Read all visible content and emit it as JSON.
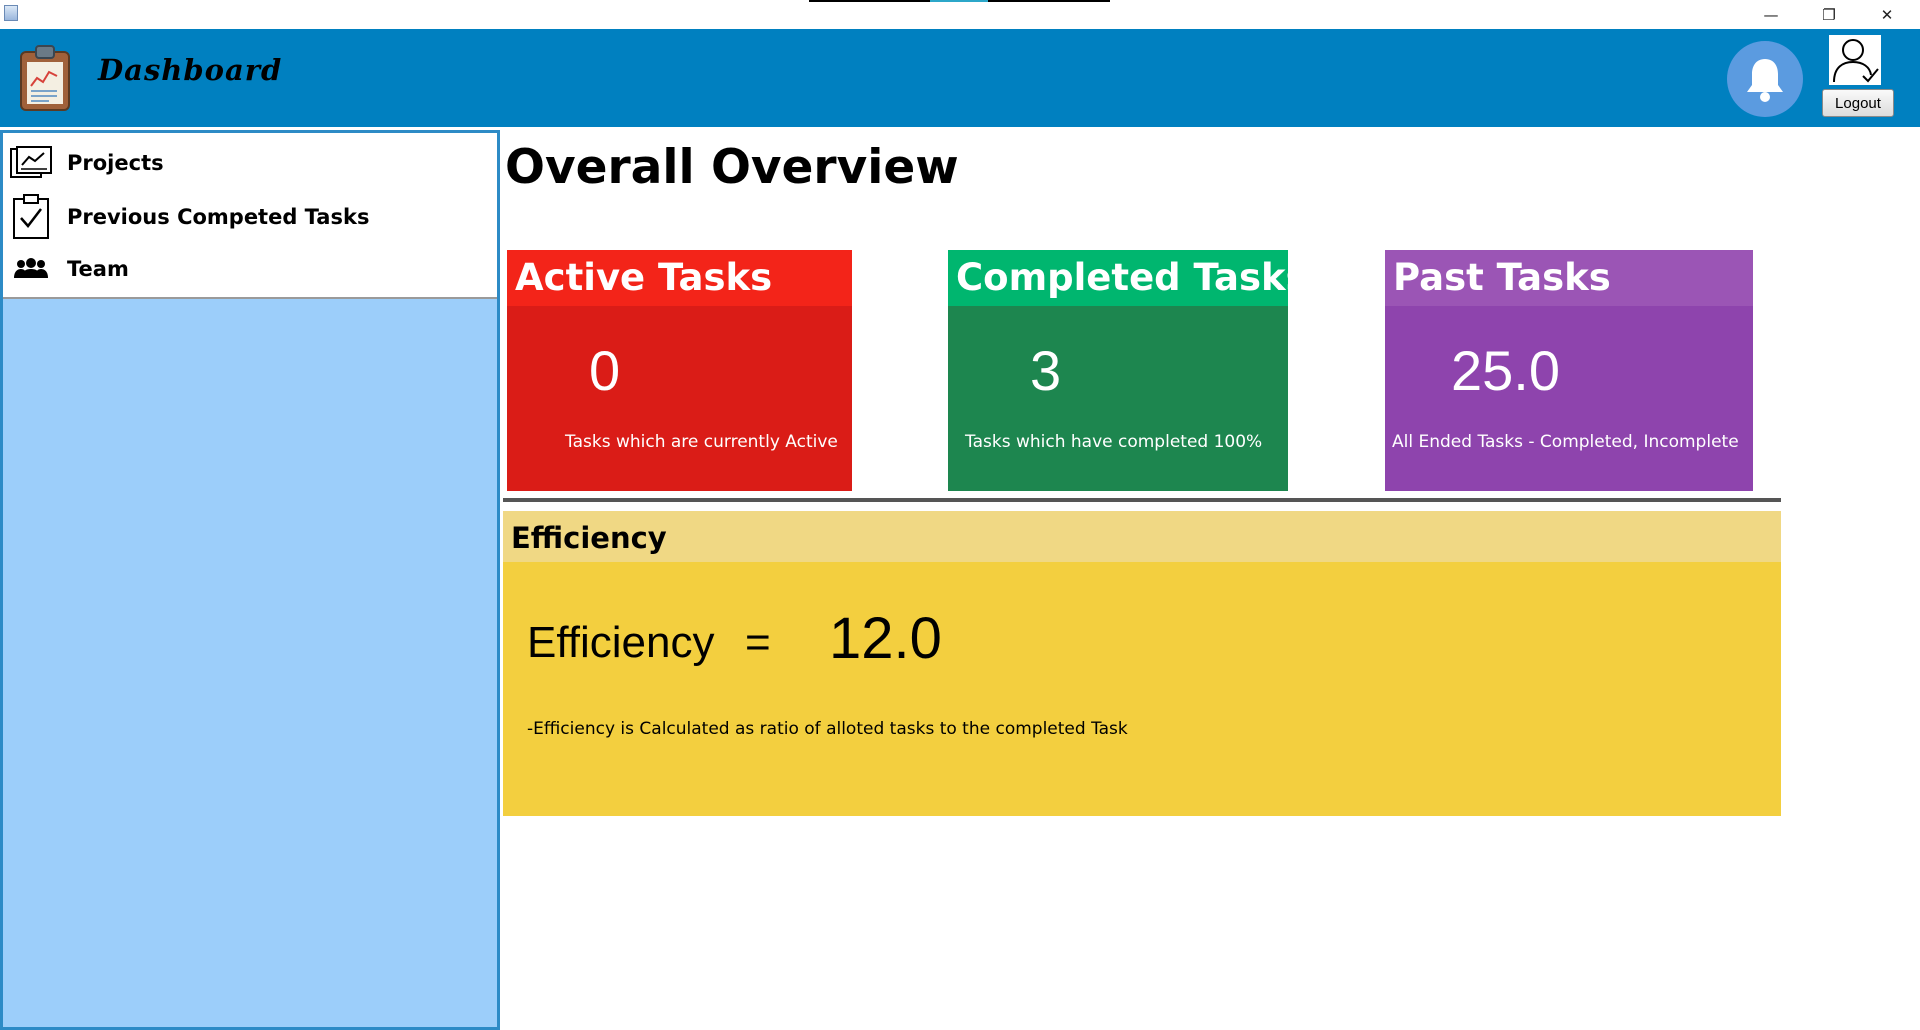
{
  "window": {
    "minimize_symbol": "—",
    "maximize_symbol": "❐",
    "close_symbol": "✕"
  },
  "header": {
    "title": "Dashboard",
    "logo_icon": "clipboard-chart-icon",
    "bell_icon": "bell-icon",
    "user_icon": "user-check-icon",
    "logout_label": "Logout",
    "background": "#0080c0"
  },
  "sidebar": {
    "items": [
      {
        "label": "Projects",
        "icon": "chart-document-icon"
      },
      {
        "label": "Previous Competed Tasks",
        "icon": "clipboard-check-icon"
      },
      {
        "label": "Team",
        "icon": "team-icon"
      }
    ],
    "panel_color": "#9ccefa"
  },
  "main": {
    "title": "Overall Overview",
    "cards": [
      {
        "title": "Active Tasks",
        "value": "0",
        "description": "Tasks which are currently Active",
        "color": "#da1c17"
      },
      {
        "title": "Completed Tasks",
        "value": "3",
        "description": "Tasks which have completed 100%",
        "color": "#1d864f"
      },
      {
        "title": "Past Tasks",
        "value": "25.0",
        "description": "All Ended Tasks - Completed, Incomplete",
        "color": "#8e44ad"
      }
    ],
    "efficiency": {
      "title": "Efficiency",
      "label": "Efficiency",
      "equals": "=",
      "value": "12.0",
      "note": "-Efficiency is Calculated as ratio of alloted tasks to the completed Task",
      "color": "#f3cf3f"
    }
  }
}
